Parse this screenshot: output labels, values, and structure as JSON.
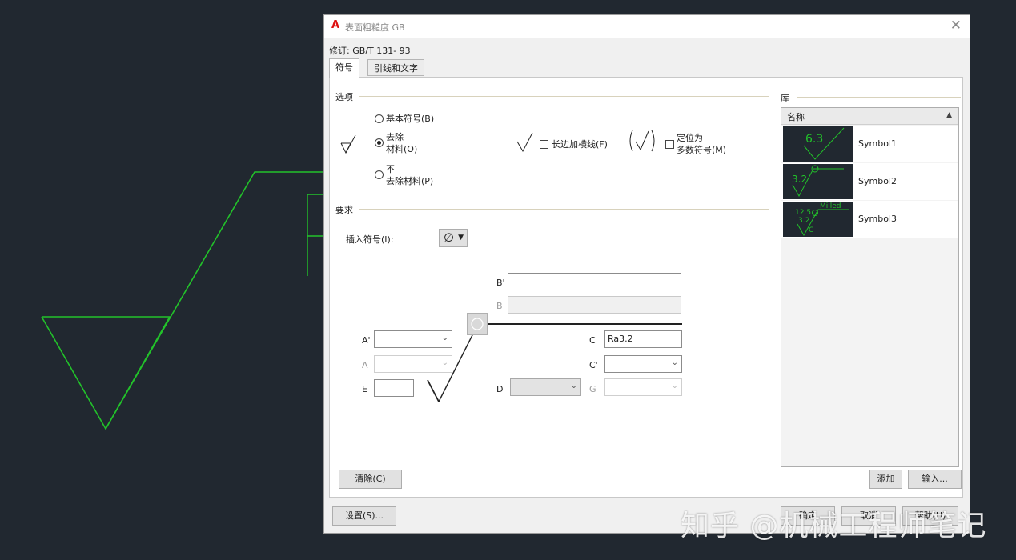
{
  "dialog": {
    "title": "表面粗糙度 GB",
    "revision": "修订: GB/T 131- 93"
  },
  "tabs": [
    {
      "label": "符号",
      "active": true
    },
    {
      "label": "引线和文字",
      "active": false
    }
  ],
  "options": {
    "section_label": "选项",
    "radio_basic": "基本符号(B)",
    "radio_remove_line1": "去除",
    "radio_remove_line2": "材料(O)",
    "radio_noremove_line1": "不",
    "radio_noremove_line2": "去除材料(P)",
    "selected_radio": "remove",
    "checkbox_long_edge": "长边加横线(F)",
    "checkbox_majority_line1": "定位为",
    "checkbox_majority_line2": "多数符号(M)"
  },
  "requirements": {
    "section_label": "要求",
    "insert_symbol_label": "插入符号(I):",
    "insert_symbol_value": "∅",
    "field_labels": {
      "b_prime": "B'",
      "b": "B",
      "a_prime": "A'",
      "a": "A",
      "e": "E",
      "c": "C",
      "c_prime": "C'",
      "d": "D",
      "g": "G"
    },
    "c_value": "Ra3.2"
  },
  "library": {
    "section_label": "库",
    "column_name": "名称",
    "items": [
      {
        "name": "Symbol1",
        "thumb_text": "6.3"
      },
      {
        "name": "Symbol2",
        "thumb_text": "3.2"
      },
      {
        "name": "Symbol3",
        "thumb_text": "12.5",
        "thumb_text2": "3.2",
        "thumb_text3": "Milled",
        "thumb_text4": "C"
      }
    ]
  },
  "buttons": {
    "clear": "清除(C)",
    "add": "添加",
    "import": "输入...",
    "settings": "设置(S)...",
    "ok": "确定",
    "cancel": "取消",
    "help": "帮助(H)"
  },
  "watermark": "知乎 @机械工程师笔记",
  "colors": {
    "cad_green": "#22c22a",
    "background": "#212830"
  }
}
